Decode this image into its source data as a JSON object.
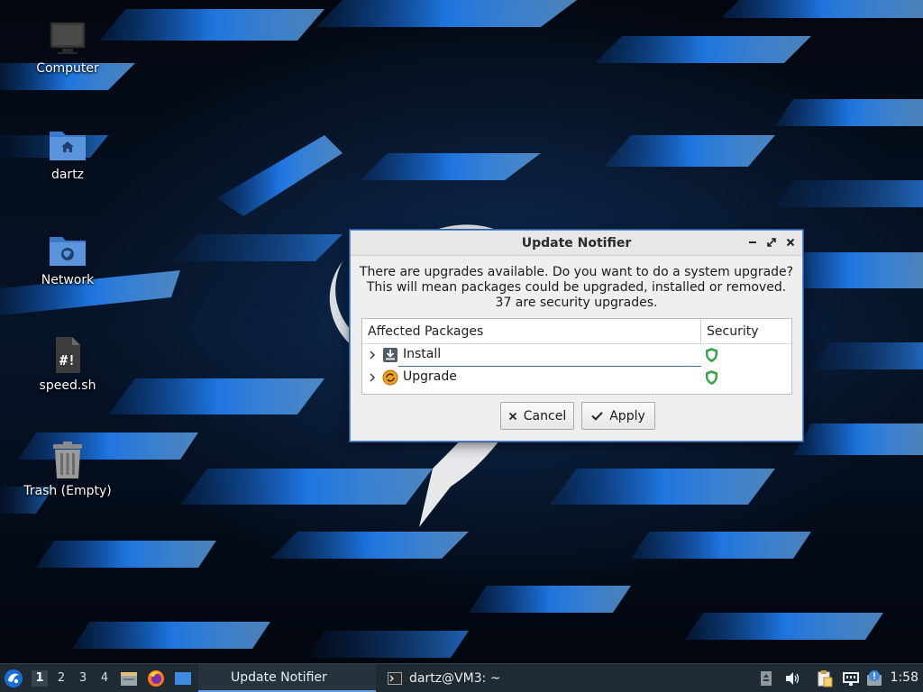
{
  "desktop": {
    "icons": [
      {
        "label": "Computer",
        "icon": "computer-icon"
      },
      {
        "label": "dartz",
        "icon": "home-folder-icon"
      },
      {
        "label": "Network",
        "icon": "network-folder-icon"
      },
      {
        "label": "speed.sh",
        "icon": "script-file-icon"
      },
      {
        "label": "Trash (Empty)",
        "icon": "trash-icon"
      }
    ]
  },
  "dialog": {
    "title": "Update Notifier",
    "message_line1": "There are upgrades available. Do you want to do a system upgrade?",
    "message_line2": "This will mean packages could be upgraded, installed or removed.",
    "message_line3": "37 are security upgrades.",
    "table": {
      "columns": [
        "Affected Packages",
        "Security"
      ],
      "rows": [
        {
          "label": "Install",
          "icon": "download-icon",
          "security": "shield-icon"
        },
        {
          "label": "Upgrade",
          "icon": "upgrade-icon",
          "security": "shield-icon"
        }
      ]
    },
    "cancel_label": "Cancel",
    "apply_label": "Apply"
  },
  "taskbar": {
    "workspaces": [
      "1",
      "2",
      "3",
      "4"
    ],
    "active_workspace": "1",
    "tasks": [
      {
        "label": "Update Notifier",
        "active": true
      },
      {
        "label": "dartz@VM3: ~",
        "active": false
      }
    ],
    "clock": "1:58"
  },
  "colors": {
    "accent": "#3c6eb4",
    "taskbar_bg": "#1f2a33",
    "shield_green": "#3aa64a"
  }
}
